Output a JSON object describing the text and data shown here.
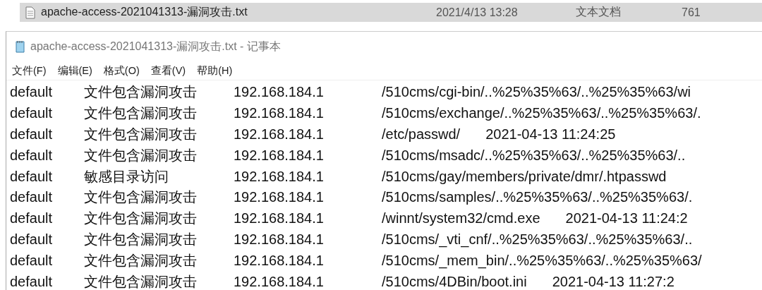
{
  "explorer_row": {
    "name": "apache-access-2021041313-漏洞攻击.txt",
    "modified": "2021/4/13 13:28",
    "type": "文本文档",
    "size": "761",
    "selected": true
  },
  "window": {
    "title": "apache-access-2021041313-漏洞攻击.txt - 记事本"
  },
  "menu": [
    "文件(F)",
    "编辑(E)",
    "格式(O)",
    "查看(V)",
    "帮助(H)"
  ],
  "lines": [
    {
      "column_1": "default",
      "column_2": "文件包含漏洞攻击",
      "column_3": "192.168.184.1",
      "column_4": "/510cms/cgi-bin/..%25%35%63/..%25%35%63/wi"
    },
    {
      "column_1": "default",
      "column_2": "文件包含漏洞攻击",
      "column_3": "192.168.184.1",
      "column_4": "/510cms/exchange/..%25%35%63/..%25%35%63/."
    },
    {
      "column_1": "default",
      "column_2": "文件包含漏洞攻击",
      "column_3": "192.168.184.1",
      "column_4": "/etc/passwd/",
      "column_5": "2021-04-13 11:24:25"
    },
    {
      "column_1": "default",
      "column_2": "文件包含漏洞攻击",
      "column_3": "192.168.184.1",
      "column_4": "/510cms/msadc/..%25%35%63/..%25%35%63/.."
    },
    {
      "column_1": "default",
      "column_2": "敏感目录访问",
      "column_3": "192.168.184.1",
      "column_4": "/510cms/gay/members/private/dmr/.htpasswd"
    },
    {
      "column_1": "default",
      "column_2": "文件包含漏洞攻击",
      "column_3": "192.168.184.1",
      "column_4": "/510cms/samples/..%25%35%63/..%25%35%63/."
    },
    {
      "column_1": "default",
      "column_2": "文件包含漏洞攻击",
      "column_3": "192.168.184.1",
      "column_4": "/winnt/system32/cmd.exe",
      "column_5": "2021-04-13 11:24:2"
    },
    {
      "column_1": "default",
      "column_2": "文件包含漏洞攻击",
      "column_3": "192.168.184.1",
      "column_4": "/510cms/_vti_cnf/..%25%35%63/..%25%35%63/.."
    },
    {
      "column_1": "default",
      "column_2": "文件包含漏洞攻击",
      "column_3": "192.168.184.1",
      "column_4": "/510cms/_mem_bin/..%25%35%63/..%25%35%63/"
    },
    {
      "column_1": "default",
      "column_2": "文件包含漏洞攻击",
      "column_3": "192.168.184.1",
      "column_4": "/510cms/4DBin/boot.ini",
      "column_5": "2021-04-13 11:27:2"
    }
  ]
}
